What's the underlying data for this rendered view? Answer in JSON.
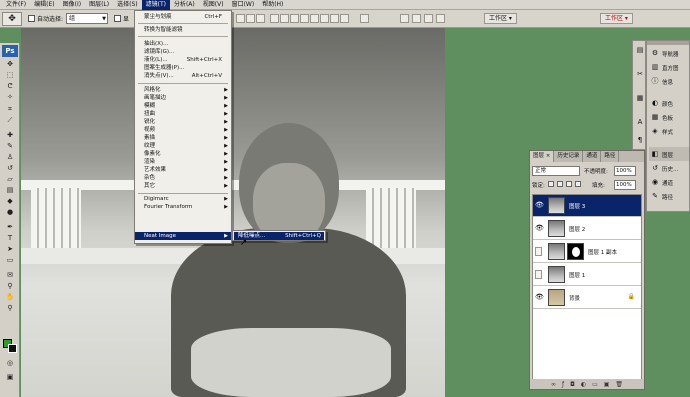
{
  "menubar": {
    "items": [
      "文件(F)",
      "编辑(E)",
      "图像(I)",
      "图层(L)",
      "选择(S)",
      "滤镜(T)",
      "分析(A)",
      "视图(V)",
      "窗口(W)",
      "帮助(H)"
    ],
    "active_index": 5
  },
  "options": {
    "auto_select_label": "自动选择:",
    "auto_select_value": "组",
    "show_label": "显",
    "workspace_label": "工作区 ▾",
    "workspace_label_right": "工作区 ▾"
  },
  "filter_menu": {
    "items": [
      {
        "label": "蒙尘与划痕",
        "shortcut": "Ctrl+F"
      },
      {
        "label": "转换为智能滤镜",
        "shortcut": ""
      },
      {
        "label": "抽出(X)...",
        "shortcut": ""
      },
      {
        "label": "滤镜库(G)...",
        "shortcut": ""
      },
      {
        "label": "液化(L)...",
        "shortcut": "Shift+Ctrl+X"
      },
      {
        "label": "图案生成器(P)...",
        "shortcut": ""
      },
      {
        "label": "消失点(V)...",
        "shortcut": "Alt+Ctrl+V"
      },
      {
        "label": "风格化",
        "shortcut": ""
      },
      {
        "label": "画笔描边",
        "shortcut": ""
      },
      {
        "label": "模糊",
        "shortcut": ""
      },
      {
        "label": "扭曲",
        "shortcut": ""
      },
      {
        "label": "锐化",
        "shortcut": ""
      },
      {
        "label": "视频",
        "shortcut": ""
      },
      {
        "label": "素描",
        "shortcut": ""
      },
      {
        "label": "纹理",
        "shortcut": ""
      },
      {
        "label": "像素化",
        "shortcut": ""
      },
      {
        "label": "渲染",
        "shortcut": ""
      },
      {
        "label": "艺术效果",
        "shortcut": ""
      },
      {
        "label": "杂色",
        "shortcut": ""
      },
      {
        "label": "其它",
        "shortcut": ""
      },
      {
        "label": "Digimarc",
        "shortcut": ""
      },
      {
        "label": "Fourier Transform",
        "shortcut": ""
      },
      {
        "label": "Neat Image",
        "shortcut": ""
      }
    ],
    "highlighted": "Neat Image"
  },
  "submenu": {
    "label": "降低噪点...",
    "shortcut": "Shift+Ctrl+Q"
  },
  "layers_panel": {
    "tabs": [
      "图层 ×",
      "历史记录",
      "通道",
      "路径"
    ],
    "blend_mode": "正常",
    "opacity_label": "不透明度:",
    "opacity_value": "100%",
    "lock_label": "锁定:",
    "fill_label": "填充:",
    "fill_value": "100%",
    "layers": [
      {
        "name": "图层 3",
        "visible": true,
        "selected": true,
        "mask": false
      },
      {
        "name": "图层 2",
        "visible": true,
        "selected": false,
        "mask": false
      },
      {
        "name": "图层 1 副本",
        "visible": false,
        "selected": false,
        "mask": true
      },
      {
        "name": "图层 1",
        "visible": false,
        "selected": false,
        "mask": false
      },
      {
        "name": "背景",
        "visible": true,
        "selected": false,
        "mask": false
      }
    ]
  },
  "dock": {
    "items": [
      "导航器",
      "直方图",
      "信息",
      "颜色",
      "色板",
      "样式",
      "图层",
      "历史...",
      "通道",
      "路径"
    ]
  },
  "toolbox": {
    "logo": "Ps"
  },
  "colors": {
    "menu_highlight": "#0a246a",
    "workspace_bg": "#5f8f5f",
    "fg_color": "#2aa02a",
    "bg_color": "#111111"
  }
}
